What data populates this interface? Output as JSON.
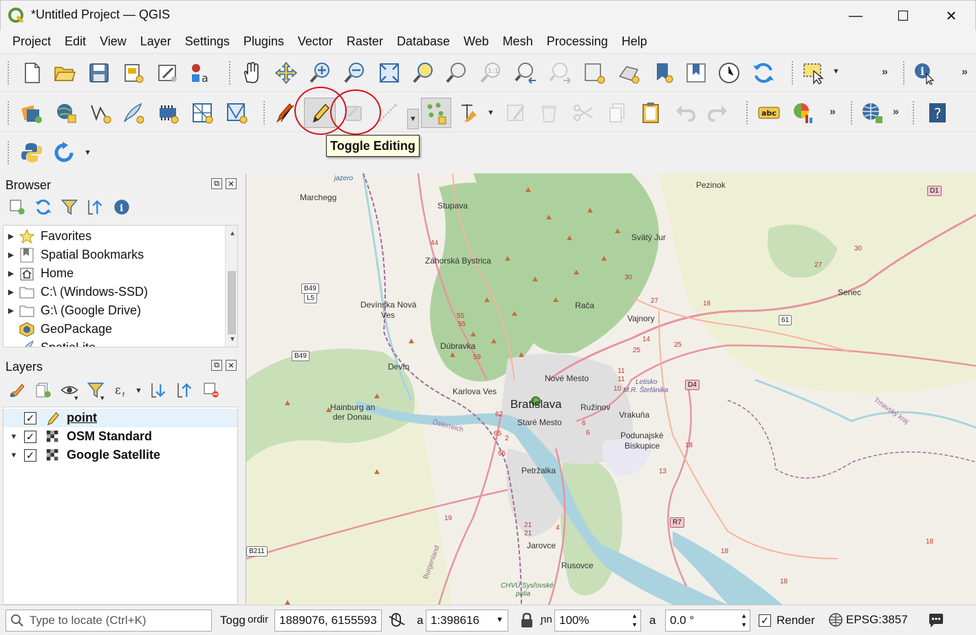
{
  "window": {
    "title": "*Untitled Project — QGIS",
    "minimize": "—",
    "maximize": "☐",
    "close": "✕"
  },
  "menu": [
    {
      "label": "Project"
    },
    {
      "label": "Edit"
    },
    {
      "label": "View"
    },
    {
      "label": "Layer"
    },
    {
      "label": "Settings"
    },
    {
      "label": "Plugins"
    },
    {
      "label": "Vector"
    },
    {
      "label": "Raster"
    },
    {
      "label": "Database"
    },
    {
      "label": "Web"
    },
    {
      "label": "Mesh"
    },
    {
      "label": "Processing"
    },
    {
      "label": "Help"
    }
  ],
  "tooltip": {
    "text": "Toggle Editing"
  },
  "browser": {
    "title": "Browser",
    "items": [
      {
        "label": "Favorites",
        "icon": "star-icon"
      },
      {
        "label": "Spatial Bookmarks",
        "icon": "bookmark-icon"
      },
      {
        "label": "Home",
        "icon": "home-icon"
      },
      {
        "label": "C:\\ (Windows-SSD)",
        "icon": "folder-icon"
      },
      {
        "label": "G:\\ (Google Drive)",
        "icon": "folder-icon"
      },
      {
        "label": "GeoPackage",
        "icon": "geopackage-icon"
      },
      {
        "label": "SpatiaLite",
        "icon": "feather-icon"
      }
    ]
  },
  "layers": {
    "title": "Layers",
    "items": [
      {
        "label": "point",
        "checked": "✓",
        "icon": "pencil-edit-icon"
      },
      {
        "label": "OSM Standard",
        "checked": "✓",
        "icon": "raster-layer-icon"
      },
      {
        "label": "Google Satellite",
        "checked": "✓",
        "icon": "raster-layer-icon"
      }
    ]
  },
  "map": {
    "places": [
      "Marchegg",
      "Stupava",
      "Pezinok",
      "Svätý Jur",
      "Záhorská Bystrica",
      "Devínska Nová",
      "Ves",
      "Rača",
      "Senec",
      "Vajnory",
      "Dúbravka",
      "Devín",
      "Nové Mesto",
      "Karlova Ves",
      "Bratislava",
      "Ružinov",
      "Hainburg an",
      "der Donau",
      "Staré Mesto",
      "Vrakuňa",
      "Podunajské",
      "Biskupice",
      "Petržalka",
      "Jarovce",
      "Rusovce",
      "Letisko",
      "M.R. Štefánika",
      "Österreich",
      "Burgenland",
      "Trnavský kraj",
      "CHVÚ Sysľovské",
      "polia",
      "jazero"
    ],
    "road_shields": [
      "D1",
      "B49",
      "L5",
      "B49",
      "61",
      "D4",
      "R7",
      "B211"
    ],
    "road_numbers": [
      "44",
      "30",
      "27",
      "30",
      "27",
      "18",
      "55",
      "55",
      "59",
      "14",
      "25",
      "25",
      "62",
      "65",
      "65",
      "11",
      "11",
      "10",
      "6",
      "6",
      "18",
      "13",
      "19",
      "21",
      "21",
      "4",
      "2",
      "18",
      "18",
      "18"
    ]
  },
  "statusbar": {
    "locate_placeholder": "Type to locate (Ctrl+K)",
    "toggle_label": "Togg",
    "coord_label": "ordir",
    "coordinate": "1889076, 6155593",
    "scale_label": "a",
    "scale": "1:398616",
    "magnifier_label": "ɲn",
    "magnifier": "100%",
    "rotation_label": "a",
    "rotation": "0.0 °",
    "render_label": "Render",
    "render_checked": "✓",
    "crs": "EPSG:3857"
  },
  "colors": {
    "map_bg": "#f2efe9",
    "forest": "#add19e",
    "water": "#aad3df",
    "urban": "#e0dfdf",
    "motorway": "#e892a2",
    "trunk": "#f9b29c",
    "border": "#9e6b9a",
    "highlight": "#d8101a",
    "tooltip_bg": "#ffffe1"
  }
}
